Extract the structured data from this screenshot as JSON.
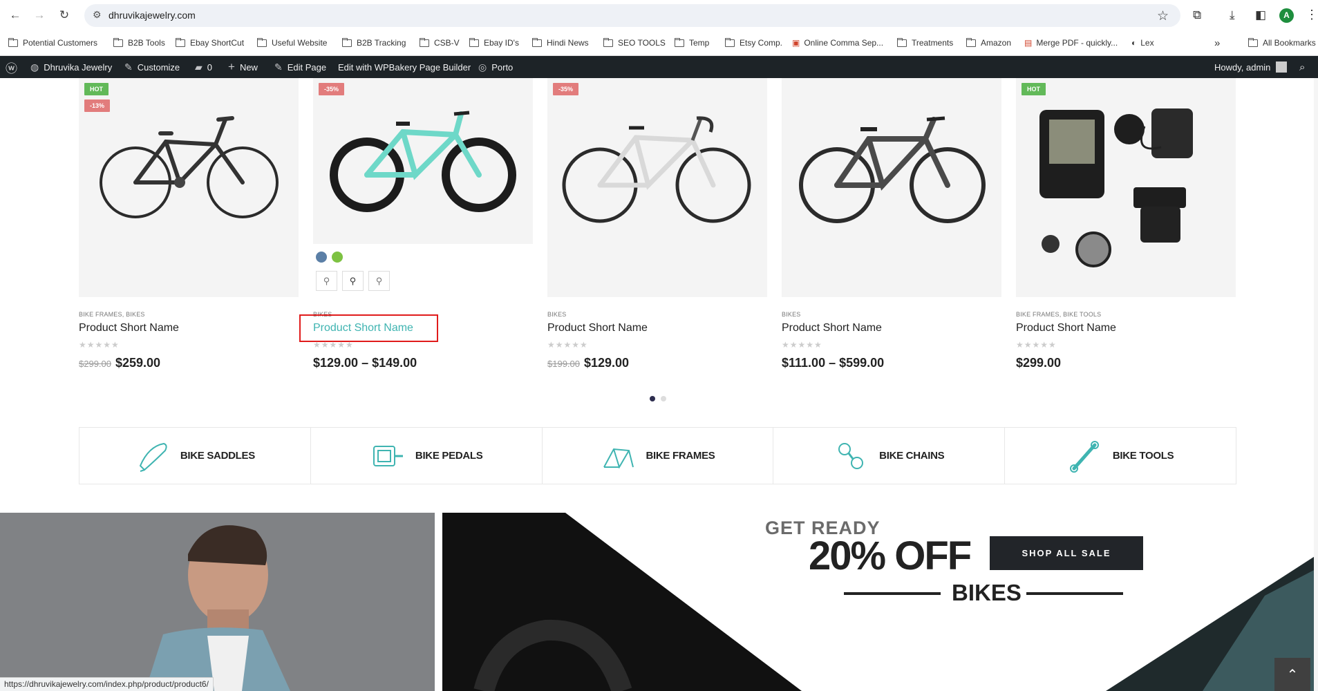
{
  "browser": {
    "url": "dhruvikajewelry.com",
    "avatar_letter": "A",
    "bookmarks": [
      "Potential Customers",
      "B2B Tools",
      "Ebay ShortCut",
      "Useful Website",
      "B2B Tracking",
      "CSB-V",
      "Ebay ID's",
      "Hindi News",
      "SEO TOOLS",
      "Temp",
      "Etsy Comp.",
      "Online Comma Sep...",
      "Treatments",
      "Amazon",
      "Merge PDF - quickly...",
      "Lex"
    ],
    "all_bookmarks": "All Bookmarks",
    "status_url": "https://dhruvikajewelry.com/index.php/product/product6/"
  },
  "adminbar": {
    "site_name": "Dhruvika Jewelry",
    "customize": "Customize",
    "comments_count": "0",
    "new": "New",
    "edit_page": "Edit Page",
    "wpbakery": "Edit with WPBakery Page Builder",
    "theme": "Porto",
    "howdy": "Howdy, admin"
  },
  "products": [
    {
      "badges": [
        "HOT",
        "-13%"
      ],
      "categories": "BIKE FRAMES, BIKES",
      "name": "Product Short Name",
      "old_price": "$299.00",
      "price": "$259.00"
    },
    {
      "badges": [
        "-35%"
      ],
      "categories": "BIKES",
      "name": "Product Short Name",
      "old_price": "",
      "price": "$129.00 – $149.00",
      "swatch_colors": [
        "#5b7fa6",
        "#7dc242"
      ]
    },
    {
      "badges": [
        "-35%"
      ],
      "categories": "BIKES",
      "name": "Product Short Name",
      "old_price": "$199.00",
      "price": "$129.00"
    },
    {
      "badges": [],
      "categories": "BIKES",
      "name": "Product Short Name",
      "old_price": "",
      "price": "$111.00 – $599.00"
    },
    {
      "badges": [
        "HOT"
      ],
      "categories": "BIKE FRAMES, BIKE TOOLS",
      "name": "Product Short Name",
      "old_price": "",
      "price": "$299.00"
    }
  ],
  "rating_stars": "★★★★★",
  "categories_strip": [
    "BIKE SADDLES",
    "BIKE PEDALS",
    "BIKE FRAMES",
    "BIKE CHAINS",
    "BIKE TOOLS"
  ],
  "promo": {
    "get_ready": "GET READY",
    "discount": "20% OFF",
    "button": "SHOP ALL SALE",
    "subject": "BIKES"
  },
  "colors": {
    "accent": "#3fb4b1",
    "hot_badge": "#62b959",
    "sale_badge": "#e27c7c",
    "admin_bar": "#1d2327",
    "highlight": "#e01b1b"
  }
}
